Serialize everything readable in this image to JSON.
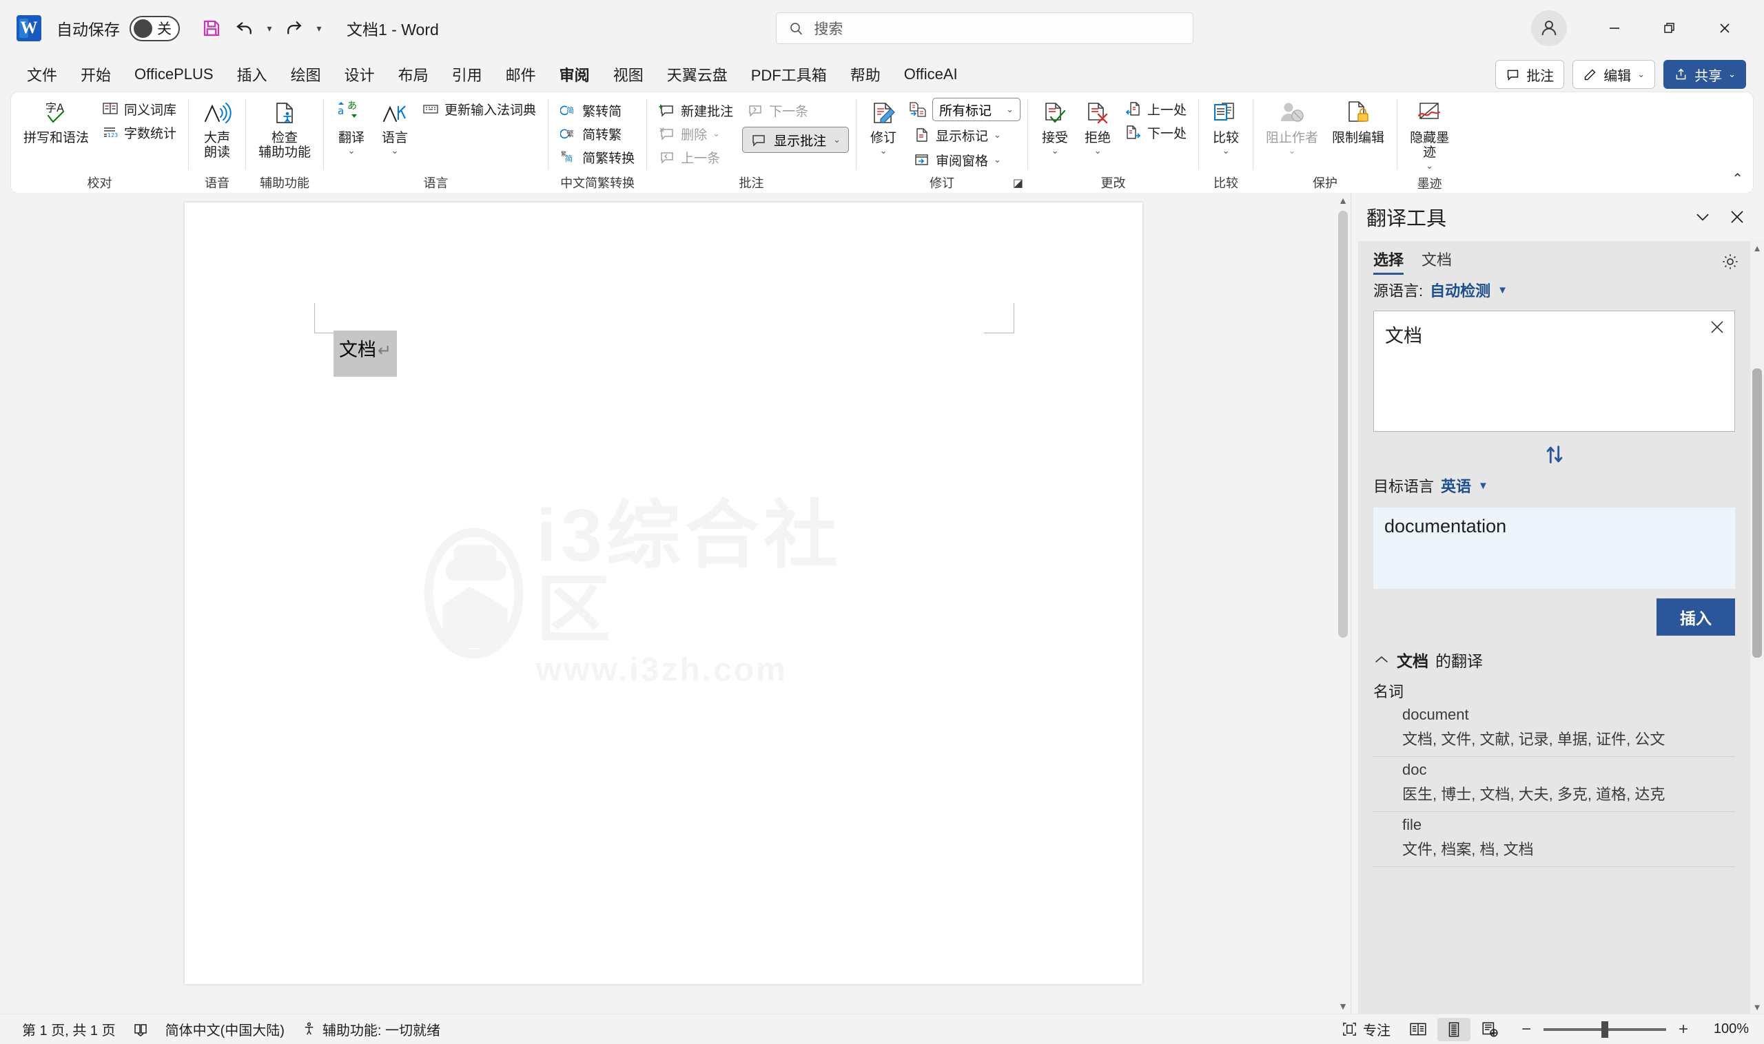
{
  "titlebar": {
    "app_icon": "word-logo",
    "autosave_label": "自动保存",
    "autosave_state": "关",
    "save_tooltip": "保存",
    "undo_tooltip": "撤消",
    "redo_tooltip": "恢复",
    "customize_tooltip": "自定义快速访问工具栏",
    "document_title": "文档1 - Word",
    "search_placeholder": "搜索",
    "account_tooltip": "账户",
    "minimize_tooltip": "最小化",
    "restore_tooltip": "向下还原",
    "close_tooltip": "关闭"
  },
  "tabs": [
    {
      "label": "文件",
      "active": false
    },
    {
      "label": "开始",
      "active": false
    },
    {
      "label": "OfficePLUS",
      "active": false
    },
    {
      "label": "插入",
      "active": false
    },
    {
      "label": "绘图",
      "active": false
    },
    {
      "label": "设计",
      "active": false
    },
    {
      "label": "布局",
      "active": false
    },
    {
      "label": "引用",
      "active": false
    },
    {
      "label": "邮件",
      "active": false
    },
    {
      "label": "审阅",
      "active": true
    },
    {
      "label": "视图",
      "active": false
    },
    {
      "label": "天翼云盘",
      "active": false
    },
    {
      "label": "PDF工具箱",
      "active": false
    },
    {
      "label": "帮助",
      "active": false
    },
    {
      "label": "OfficeAI",
      "active": false
    }
  ],
  "tabbar_right": {
    "comments_label": "批注",
    "editing_label": "编辑",
    "share_label": "共享"
  },
  "ribbon": {
    "collapse_tooltip": "折叠功能区",
    "groups": [
      {
        "name": "校对",
        "label": "校对",
        "big_buttons": [
          {
            "label": "拼写和语法",
            "icon": "spelling-grammar-icon"
          }
        ],
        "small_buttons": [
          {
            "label": "同义词库",
            "icon": "thesaurus-icon",
            "disabled": false
          },
          {
            "label": "字数统计",
            "icon": "word-count-icon",
            "disabled": false
          }
        ]
      },
      {
        "name": "语音",
        "label": "语音",
        "big_buttons": [
          {
            "label": "大声\n朗读",
            "icon": "read-aloud-icon"
          }
        ],
        "small_buttons": []
      },
      {
        "name": "辅助功能",
        "label": "辅助功能",
        "big_buttons": [
          {
            "label": "检查\n辅助功能",
            "icon": "check-accessibility-icon",
            "has_caret": true
          }
        ],
        "small_buttons": []
      },
      {
        "name": "语言",
        "label": "语言",
        "big_buttons": [
          {
            "label": "翻译",
            "icon": "translate-icon",
            "has_caret": true
          },
          {
            "label": "语言",
            "icon": "language-icon",
            "has_caret": true
          }
        ],
        "small_buttons": [
          {
            "label": "更新输入法词典",
            "icon": "ime-dictionary-icon",
            "disabled": false
          }
        ]
      },
      {
        "name": "中文简繁转换",
        "label": "中文简繁转换",
        "big_buttons": [],
        "small_buttons": [
          {
            "label": "繁转简",
            "icon": "trad-to-simp-icon",
            "disabled": false
          },
          {
            "label": "简转繁",
            "icon": "simp-to-trad-icon",
            "disabled": false
          },
          {
            "label": "简繁转换",
            "icon": "simp-trad-convert-icon",
            "disabled": false
          }
        ]
      },
      {
        "name": "批注",
        "label": "批注",
        "big_buttons": [],
        "small_buttons": [
          {
            "label": "新建批注",
            "icon": "new-comment-icon",
            "disabled": false
          },
          {
            "label": "删除",
            "icon": "delete-comment-icon",
            "disabled": true,
            "has_caret": true
          },
          {
            "label": "上一条",
            "icon": "previous-comment-icon",
            "disabled": true
          },
          {
            "label": "下一条",
            "icon": "next-comment-icon",
            "disabled": true
          }
        ],
        "toggle_button": {
          "label": "显示批注",
          "icon": "show-comments-icon",
          "has_caret": true,
          "pressed": true
        }
      },
      {
        "name": "修订",
        "label": "修订",
        "big_buttons": [
          {
            "label": "修订",
            "icon": "track-changes-icon",
            "has_caret": true
          }
        ],
        "dropdown": {
          "value": "所有标记"
        },
        "small_buttons": [
          {
            "label": "显示标记",
            "icon": "show-markup-icon",
            "has_caret": true,
            "disabled": false
          },
          {
            "label": "审阅窗格",
            "icon": "reviewing-pane-icon",
            "has_caret": true,
            "disabled": false
          }
        ],
        "dialog_launcher": true
      },
      {
        "name": "更改",
        "label": "更改",
        "big_buttons": [
          {
            "label": "接受",
            "icon": "accept-change-icon",
            "has_caret": true
          },
          {
            "label": "拒绝",
            "icon": "reject-change-icon",
            "has_caret": true
          }
        ],
        "small_buttons": [
          {
            "label": "上一处",
            "icon": "previous-change-icon",
            "disabled": false
          },
          {
            "label": "下一处",
            "icon": "next-change-icon",
            "disabled": false
          }
        ]
      },
      {
        "name": "比较",
        "label": "比较",
        "big_buttons": [
          {
            "label": "比较",
            "icon": "compare-icon",
            "has_caret": true
          }
        ],
        "small_buttons": []
      },
      {
        "name": "保护",
        "label": "保护",
        "big_buttons": [
          {
            "label": "阻止作者",
            "icon": "block-authors-icon",
            "has_caret": true,
            "disabled": true
          },
          {
            "label": "限制编辑",
            "icon": "restrict-editing-icon"
          }
        ],
        "small_buttons": []
      },
      {
        "name": "墨迹",
        "label": "墨迹",
        "big_buttons": [
          {
            "label": "隐藏墨\n迹",
            "icon": "hide-ink-icon",
            "has_caret": true
          }
        ],
        "small_buttons": []
      }
    ]
  },
  "document": {
    "selected_text": "文档",
    "paragraph_mark": "↵",
    "watermark_cn": "i3综合社区",
    "watermark_url": "www.i3zh.com"
  },
  "translator": {
    "title": "翻译工具",
    "minimize_tooltip": "最小化",
    "close_tooltip": "关闭",
    "settings_tooltip": "设置",
    "tabs": [
      {
        "label": "选择",
        "active": true
      },
      {
        "label": "文档",
        "active": false
      }
    ],
    "source_language_label": "源语言:",
    "source_language_value": "自动检测",
    "source_text": "文档",
    "clear_tooltip": "清除",
    "swap_tooltip": "交换语言",
    "target_language_label": "目标语言",
    "target_language_value": "英语",
    "result_text": "documentation",
    "insert_label": "插入",
    "dictionary_header_word": "文档",
    "dictionary_header_suffix": "的翻译",
    "part_of_speech": "名词",
    "entries": [
      {
        "word": "document",
        "meanings": "文档, 文件, 文献, 记录, 单据, 证件, 公文"
      },
      {
        "word": "doc",
        "meanings": "医生, 博士, 文档, 大夫, 多克, 道格, 达克"
      },
      {
        "word": "file",
        "meanings": "文件, 档案, 档, 文档"
      }
    ]
  },
  "statusbar": {
    "page_info": "第 1 页, 共 1 页",
    "proofing_icon": "proofing-icon",
    "language": "简体中文(中国大陆)",
    "accessibility": "辅助功能: 一切就绪",
    "focus_label": "专注",
    "view_read_tooltip": "阅读视图",
    "view_print_tooltip": "页面视图",
    "view_web_tooltip": "Web 版式视图",
    "zoom_out": "−",
    "zoom_in": "+",
    "zoom_value": "100%"
  },
  "colors": {
    "accent": "#2b579a",
    "chrome": "#f3f3f3",
    "pane_bg": "#e6e6e6",
    "result_bg": "#eef4fb",
    "selection": "#c6c6c6"
  }
}
